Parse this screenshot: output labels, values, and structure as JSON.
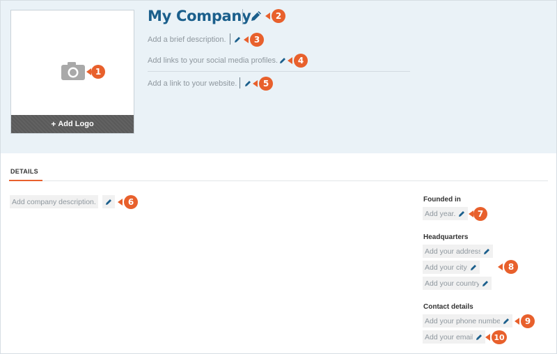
{
  "header": {
    "company_name": "My Company",
    "add_logo_label": "Add Logo",
    "add_logo_plus": "+",
    "description_placeholder": "Add a brief description.",
    "social_placeholder": "Add links to your social media profiles.",
    "website_placeholder": "Add a link to your website."
  },
  "tabs": [
    {
      "label": "DETAILS",
      "active": true
    }
  ],
  "details": {
    "company_description_placeholder": "Add company description."
  },
  "sidebar": {
    "founded": {
      "title": "Founded in",
      "year_placeholder": "Add year."
    },
    "headquarters": {
      "title": "Headquarters",
      "address_placeholder": "Add your address.",
      "city_placeholder": "Add your city.",
      "country_placeholder": "Add your country."
    },
    "contact": {
      "title": "Contact details",
      "phone_placeholder": "Add your phone number.",
      "email_placeholder": "Add your email."
    }
  },
  "badges": [
    "1",
    "2",
    "3",
    "4",
    "5",
    "6",
    "7",
    "8",
    "9",
    "10"
  ],
  "colors": {
    "accent": "#e8602c",
    "brand_blue": "#1b5f8c",
    "header_bg": "#eaf2f7",
    "pencil": "#1b5f8c"
  },
  "icons": {
    "logo_placeholder": "camera-icon",
    "edit": "pencil-icon"
  }
}
